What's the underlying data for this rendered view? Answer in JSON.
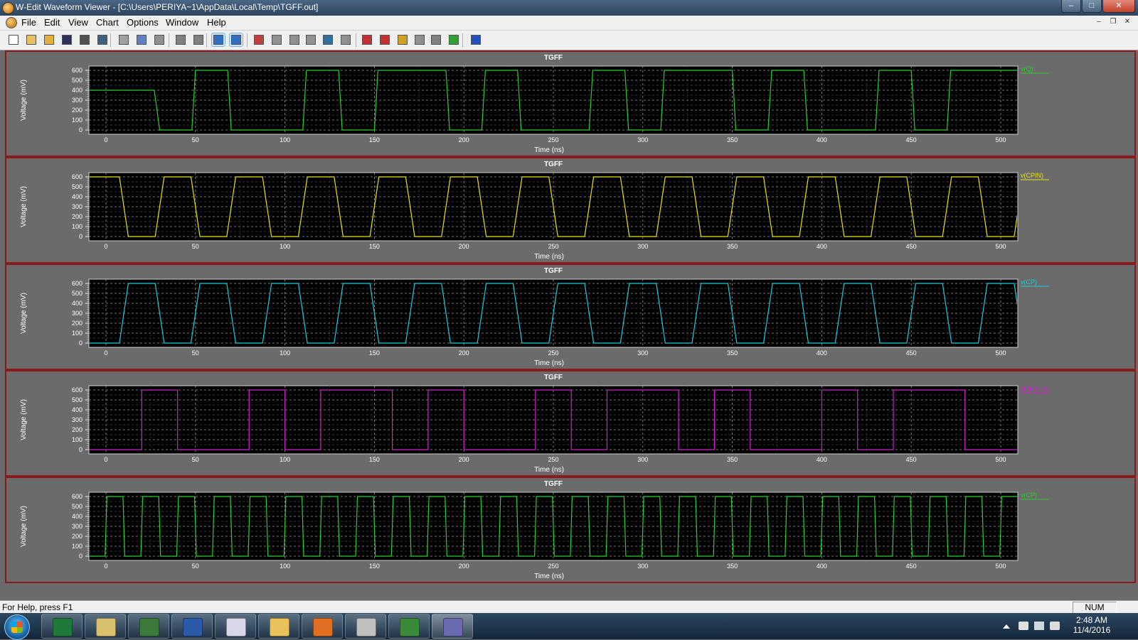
{
  "window": {
    "title": "W-Edit Waveform Viewer - [C:\\Users\\PERIYA~1\\AppData\\Local\\Temp\\TGFF.out]",
    "controls": [
      "minimize",
      "maximize",
      "close"
    ]
  },
  "menu": [
    "File",
    "Edit",
    "View",
    "Chart",
    "Options",
    "Window",
    "Help"
  ],
  "toolbar_icons": [
    "new-icon",
    "open-icon",
    "open-multiple-icon",
    "save-icon",
    "print-icon",
    "print-preview-icon",
    "cut-icon",
    "copy-icon",
    "paste-icon",
    "stack-charts-icon",
    "overlay-charts-icon",
    "home-icon",
    "zoom-fit-icon",
    "chart-properties-icon",
    "trace-icon",
    "copy-trace-icon",
    "align-icon",
    "expand-icon",
    "text-icon",
    "cursor-icon",
    "measure-icon",
    "marker-icon",
    "pause-icon",
    "play-icon",
    "export-image-icon",
    "help-book-icon"
  ],
  "charts": [
    {
      "title": "TGFF",
      "ylabel": "Voltage (mV)",
      "xlabel": "Time (ns)",
      "trace": "v(Q)",
      "color": "#2ecc2e",
      "xlim": [
        0,
        500
      ],
      "ylim": [
        0,
        600
      ],
      "yticks": [
        0,
        100,
        200,
        300,
        400,
        500,
        600
      ],
      "xticks": [
        0,
        50,
        100,
        150,
        200,
        250,
        300,
        350,
        400,
        450,
        500
      ],
      "series": [
        [
          -10,
          400
        ],
        [
          27,
          400
        ],
        [
          30,
          0
        ],
        [
          48,
          0
        ],
        [
          50,
          600
        ],
        [
          68,
          600
        ],
        [
          70,
          0
        ],
        [
          110,
          0
        ],
        [
          112,
          600
        ],
        [
          130,
          600
        ],
        [
          132,
          0
        ],
        [
          150,
          0
        ],
        [
          152,
          600
        ],
        [
          190,
          600
        ],
        [
          192,
          0
        ],
        [
          210,
          0
        ],
        [
          212,
          600
        ],
        [
          230,
          600
        ],
        [
          232,
          0
        ],
        [
          270,
          0
        ],
        [
          272,
          600
        ],
        [
          290,
          600
        ],
        [
          292,
          0
        ],
        [
          310,
          0
        ],
        [
          312,
          600
        ],
        [
          350,
          600
        ],
        [
          352,
          0
        ],
        [
          370,
          0
        ],
        [
          372,
          600
        ],
        [
          390,
          600
        ],
        [
          392,
          0
        ],
        [
          430,
          0
        ],
        [
          432,
          600
        ],
        [
          450,
          600
        ],
        [
          452,
          0
        ],
        [
          470,
          0
        ],
        [
          472,
          600
        ],
        [
          510,
          600
        ]
      ]
    },
    {
      "title": "TGFF",
      "ylabel": "Voltage (mV)",
      "xlabel": "Time (ns)",
      "trace": "v(CPIN)",
      "color": "#e8e020",
      "xlim": [
        0,
        500
      ],
      "ylim": [
        0,
        600
      ],
      "yticks": [
        0,
        100,
        200,
        300,
        400,
        500,
        600
      ],
      "xticks": [
        0,
        50,
        100,
        150,
        200,
        250,
        300,
        350,
        400,
        450,
        500
      ],
      "series": "clock:-10:20:0:600:inverted"
    },
    {
      "title": "TGFF",
      "ylabel": "Voltage (mV)",
      "xlabel": "Time (ns)",
      "trace": "v(CP)",
      "color": "#25c8d8",
      "xlim": [
        0,
        500
      ],
      "ylim": [
        0,
        600
      ],
      "yticks": [
        0,
        100,
        200,
        300,
        400,
        500,
        600
      ],
      "xticks": [
        0,
        50,
        100,
        150,
        200,
        250,
        300,
        350,
        400,
        450,
        500
      ],
      "series": "clock:-10:20:0:600:normal"
    },
    {
      "title": "TGFF",
      "ylabel": "Voltage (mV)",
      "xlabel": "Time (ns)",
      "trace": "v(data_in)",
      "color": "#d020d0",
      "xlim": [
        0,
        500
      ],
      "ylim": [
        0,
        600
      ],
      "yticks": [
        0,
        100,
        200,
        300,
        400,
        500,
        600
      ],
      "xticks": [
        0,
        50,
        100,
        150,
        200,
        250,
        300,
        350,
        400,
        450,
        500
      ],
      "series": [
        [
          -10,
          0
        ],
        [
          20,
          0
        ],
        [
          20,
          600
        ],
        [
          40,
          600
        ],
        [
          40,
          0
        ],
        [
          80,
          0
        ],
        [
          80,
          600
        ],
        [
          100,
          600
        ],
        [
          100,
          0
        ],
        [
          120,
          0
        ],
        [
          120,
          600
        ],
        [
          160,
          600
        ],
        [
          160,
          0
        ],
        [
          180,
          0
        ],
        [
          180,
          600
        ],
        [
          200,
          600
        ],
        [
          200,
          0
        ],
        [
          240,
          0
        ],
        [
          240,
          600
        ],
        [
          260,
          600
        ],
        [
          260,
          0
        ],
        [
          280,
          0
        ],
        [
          280,
          600
        ],
        [
          320,
          600
        ],
        [
          320,
          0
        ],
        [
          340,
          0
        ],
        [
          340,
          600
        ],
        [
          360,
          600
        ],
        [
          360,
          0
        ],
        [
          400,
          0
        ],
        [
          400,
          600
        ],
        [
          420,
          600
        ],
        [
          420,
          0
        ],
        [
          440,
          0
        ],
        [
          440,
          600
        ],
        [
          480,
          600
        ],
        [
          480,
          0
        ],
        [
          510,
          0
        ]
      ]
    },
    {
      "title": "TGFF",
      "ylabel": "Voltage (mV)",
      "xlabel": "Time (ns)",
      "trace": "v(CP)",
      "color": "#2ecc2e",
      "xlim": [
        0,
        500
      ],
      "ylim": [
        0,
        600
      ],
      "yticks": [
        0,
        100,
        200,
        300,
        400,
        500,
        600
      ],
      "xticks": [
        0,
        50,
        100,
        150,
        200,
        250,
        300,
        350,
        400,
        450,
        500
      ],
      "series": "clock:-10:10:0:600:square"
    }
  ],
  "status": {
    "help": "For Help, press F1",
    "num": "NUM"
  },
  "taskbar": {
    "apps": [
      "excel-icon",
      "paint-icon",
      "vim-icon",
      "word-icon",
      "text-editor-icon",
      "file-explorer-icon",
      "pdf-icon",
      "camera-icon",
      "schematic-icon",
      "waveform-icon"
    ],
    "time": "2:48 AM",
    "date": "11/4/2016"
  }
}
